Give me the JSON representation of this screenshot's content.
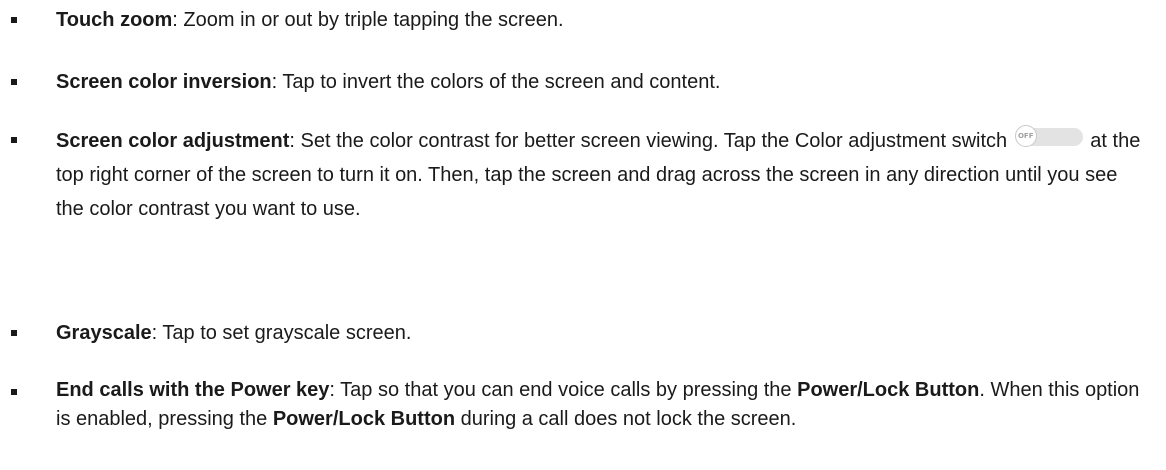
{
  "items": [
    {
      "term": "Touch zoom",
      "text": ": Zoom in or out by triple tapping the screen."
    },
    {
      "term": "Screen color inversion",
      "text": ": Tap to invert the colors of the screen and content."
    },
    {
      "term": "Screen color adjustment",
      "text_1": ": Set the color contrast for better screen viewing. Tap the Color adjustment switch",
      "switch_label": "OFF",
      "text_2": " at the top right corner of the screen to turn it on. Then, tap the screen and drag across the screen in any direction until you see the color contrast you want to use."
    },
    {
      "term": "Grayscale",
      "text": ": Tap to set grayscale screen."
    },
    {
      "term": "End calls with the Power key",
      "text_1": ": Tap so that you can end voice calls by pressing the ",
      "bold_1": "Power/Lock Button",
      "text_2": ". When this option is enabled, pressing the ",
      "bold_2": "Power/Lock Button",
      "text_3": " during a call does not lock the screen."
    }
  ]
}
